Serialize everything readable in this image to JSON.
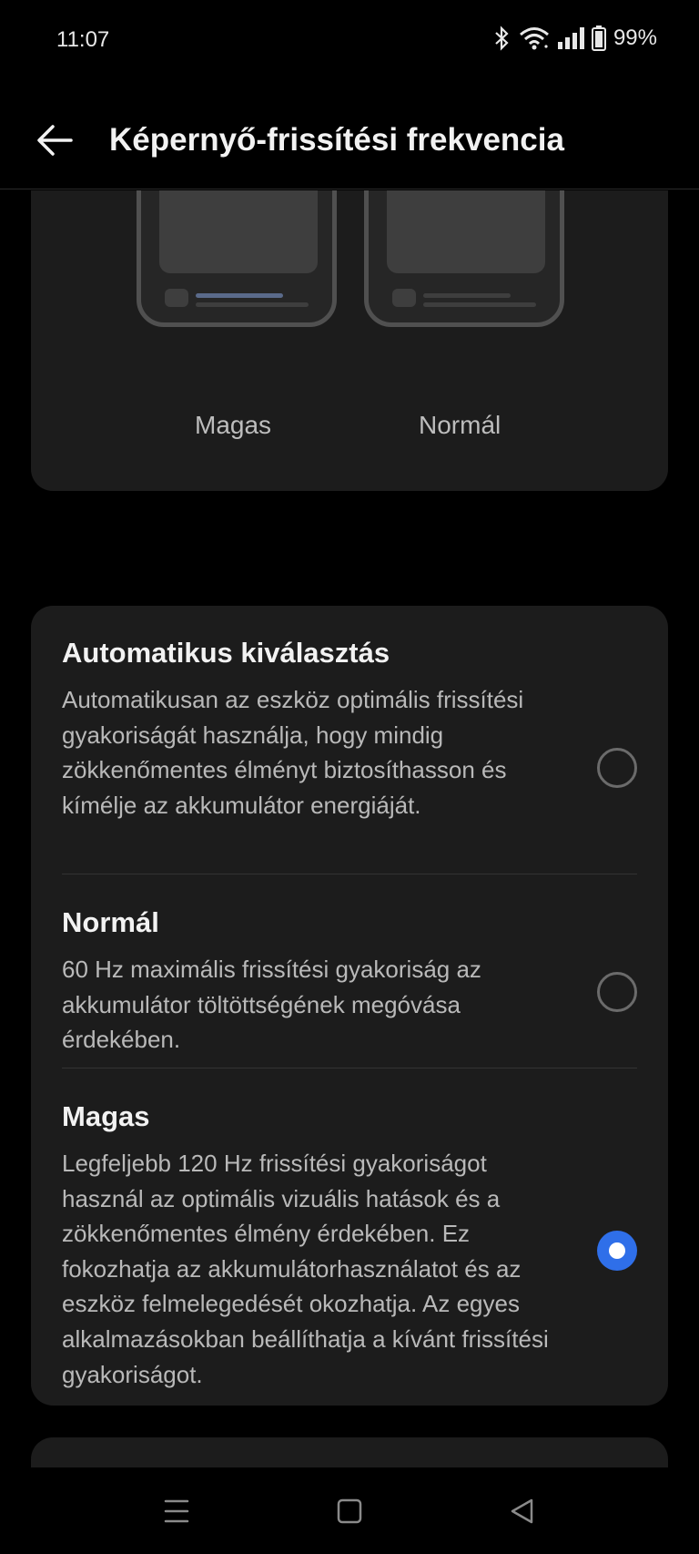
{
  "status": {
    "time": "11:07",
    "battery": "99%"
  },
  "appbar": {
    "title": "Képernyő-frissítési frekvencia"
  },
  "preview": {
    "labels": [
      "Magas",
      "Normál"
    ]
  },
  "options": [
    {
      "title": "Automatikus kiválasztás",
      "description": "Automatikusan az eszköz optimális frissítési gyakoriságát használja, hogy mindig zökkenőmentes élményt biztosíthasson és kímélje az akkumulátor energiáját.",
      "selected": false
    },
    {
      "title": "Normál",
      "description": "60 Hz maximális frissítési gyakoriság az akkumulátor töltöttségének megóvása érdekében.",
      "selected": false
    },
    {
      "title": "Magas",
      "description": "Legfeljebb 120 Hz frissítési gyakoriságot használ az optimális vizuális hatások és a zökkenőmentes élmény érdekében. Ez fokozhatja az akkumulátorhasználatot és az eszköz felmelegedését okozhatja. Az egyes alkalmazásokban beállíthatja a kívánt frissítési gyakoriságot.",
      "selected": true
    }
  ],
  "colors": {
    "accent": "#2f6fe9",
    "card": "#1c1c1c",
    "background": "#000000"
  },
  "icons": [
    "bluetooth-icon",
    "wifi-icon",
    "signal-icon",
    "battery-icon",
    "back-arrow-icon",
    "menu-icon",
    "home-icon",
    "back-triangle-icon"
  ]
}
